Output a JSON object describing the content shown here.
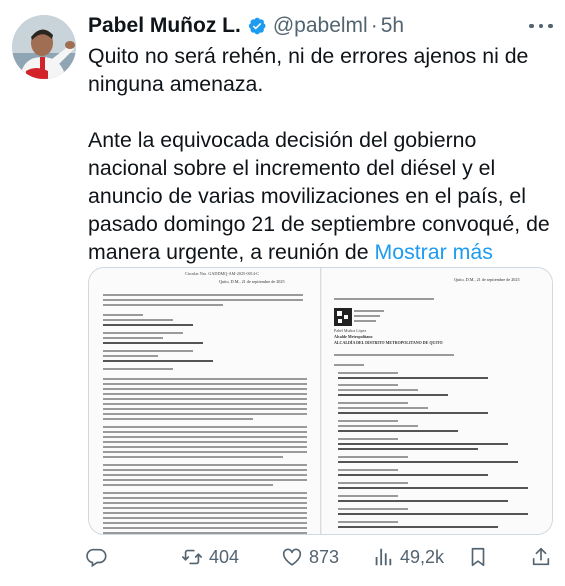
{
  "author": {
    "display_name": "Pabel Muñoz L.",
    "handle": "@pabelml",
    "separator": "·",
    "time": "5h",
    "verified": true
  },
  "tweet": {
    "paragraph_1": "Quito no será rehén, ni de errores ajenos ni de ninguna amenaza.",
    "paragraph_2": "Ante la equivocada decisión del gobierno nacional sobre el incremento del diésel y el anuncio de varias movilizaciones en el país, el pasado domingo 21 de septiembre convoqué, de manera urgente, a reunión de",
    "show_more": "Mostrar más"
  },
  "attachment": {
    "left_page": {
      "circular": "Circular Nro. GADDMQ-AM-2025-0014-C",
      "place_date": "Quito, D.M., 21 de septiembre de 2025"
    },
    "right_page": {
      "place_date": "Quito, D.M., 21 de septiembre de 2025",
      "signer_name": "Pabel Muñoz López",
      "signer_title_1": "Alcalde Metropolitano",
      "signer_title_2": "ALCALDÍA DEL DISTRITO METROPOLITANO DE QUITO"
    }
  },
  "actions": {
    "reply_count": "",
    "retweet_count": "404",
    "like_count": "873",
    "views_count": "49,2k"
  },
  "colors": {
    "text_primary": "#0f1419",
    "text_secondary": "#536471",
    "accent": "#1d9bf0",
    "border": "#cfd9de"
  },
  "icons": [
    "verified-badge-icon",
    "more-icon",
    "reply-icon",
    "retweet-icon",
    "like-icon",
    "views-icon",
    "bookmark-icon",
    "share-icon"
  ]
}
